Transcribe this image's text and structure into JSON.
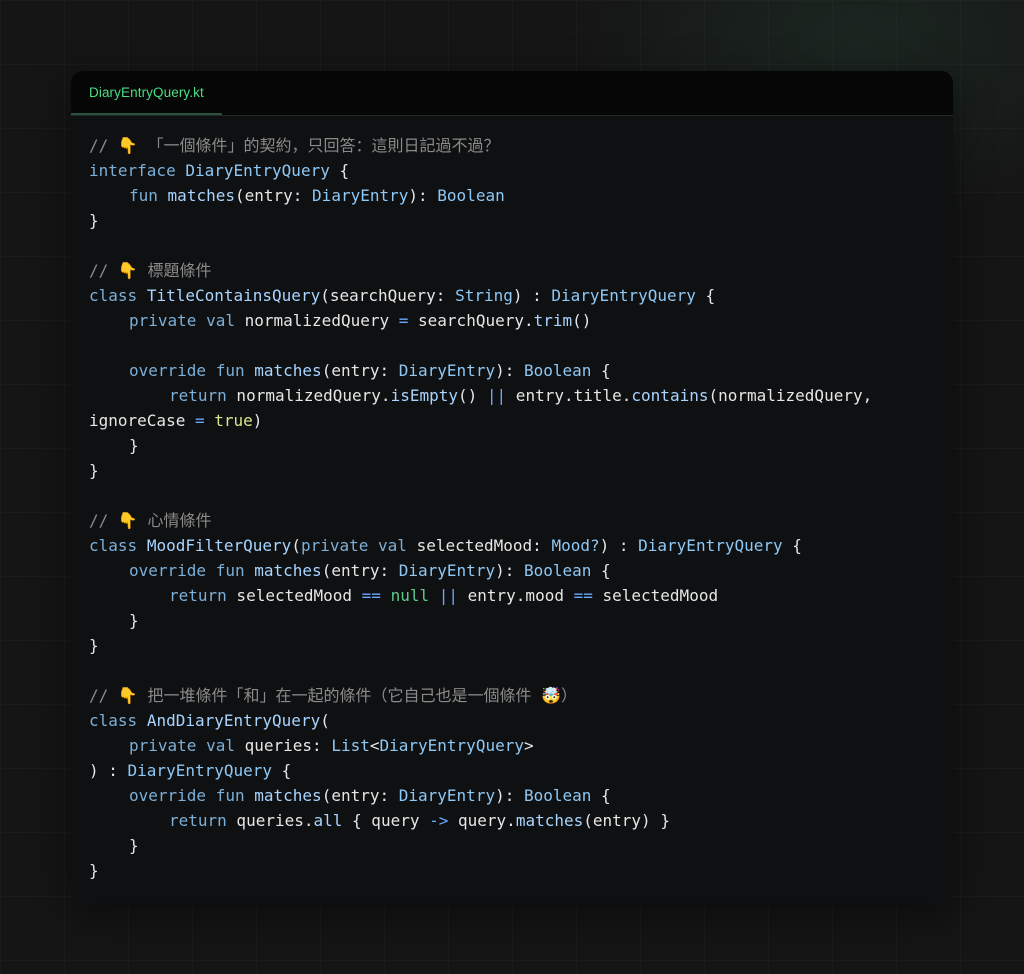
{
  "tab": {
    "filename": "DiaryEntryQuery.kt"
  },
  "code": {
    "comment1": "// 👇 「一個條件」的契約，只回答：這則日記過不過？",
    "comment2": "// 👇 標題條件",
    "comment3": "// 👇 心情條件",
    "comment4": "// 👇 把一堆條件「和」在一起的條件（它自己也是一個條件 🤯）",
    "kw_interface": "interface",
    "kw_class": "class",
    "kw_fun": "fun",
    "kw_private": "private",
    "kw_val": "val",
    "kw_override": "override",
    "kw_return": "return",
    "t_DiaryEntryQuery": "DiaryEntryQuery",
    "t_DiaryEntry": "DiaryEntry",
    "t_Boolean": "Boolean",
    "t_String": "String",
    "t_Mood": "Mood?",
    "t_List": "List",
    "t_TitleContainsQuery": "TitleContainsQuery",
    "t_MoodFilterQuery": "MoodFilterQuery",
    "t_AndDiaryEntryQuery": "AndDiaryEntryQuery",
    "f_matches": "matches",
    "f_trim": "trim",
    "f_isEmpty": "isEmpty",
    "f_contains": "contains",
    "f_all": "all",
    "lit_true": "true",
    "lit_null": "null"
  }
}
